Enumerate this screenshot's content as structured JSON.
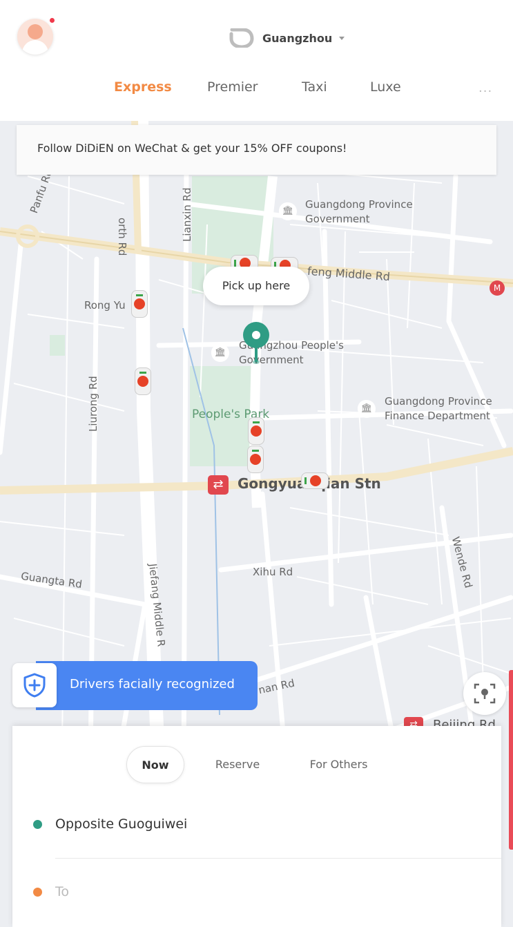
{
  "header": {
    "city": "Guangzhou",
    "tabs": [
      {
        "label": "Express",
        "active": true
      },
      {
        "label": "Premier",
        "active": false
      },
      {
        "label": "Taxi",
        "active": false
      },
      {
        "label": "Luxe",
        "active": false
      }
    ],
    "more_label": "···"
  },
  "banner": {
    "text": "Follow DiDiEN on WeChat & get your 15% OFF coupons!"
  },
  "map": {
    "labels": {
      "panfu_rd": "Panfu Rd",
      "north_rd": "orth Rd",
      "lianxin_rd": "Lianxin Rd",
      "gd_gov_1": "Guangdong Province",
      "gd_gov_2": "Government",
      "dongfeng": "feng Middle Rd",
      "rong_yu": "Rong Yu",
      "gz_gov_1": "Guangzhou People's",
      "gz_gov_2": "Government",
      "finance_1": "Guangdong Province",
      "finance_2": "Finance Department",
      "liurong_rd": "Liurong Rd",
      "peoples_park": "People's Park",
      "station": "Gongyuanqian Stn",
      "wende_rd": "Wende Rd",
      "xihu_rd": "Xihu Rd",
      "guangta_rd": "Guangta Rd",
      "jiefang_rd": "Jiefang Middle R",
      "nan_rd": "nan Rd",
      "beijing_rd": "Beijing Rd"
    },
    "pickup_label": "Pick up here",
    "security_label": "Drivers facially recognized",
    "colors": {
      "pin": "#2f9c84",
      "metro": "#e1474e",
      "security": "#4a86f2",
      "accent": "#f28a44"
    }
  },
  "panel": {
    "modes": [
      {
        "label": "Now",
        "active": true
      },
      {
        "label": "Reserve",
        "active": false
      },
      {
        "label": "For Others",
        "active": false
      }
    ],
    "from": "Opposite Guoguiwei",
    "to_placeholder": "To"
  }
}
